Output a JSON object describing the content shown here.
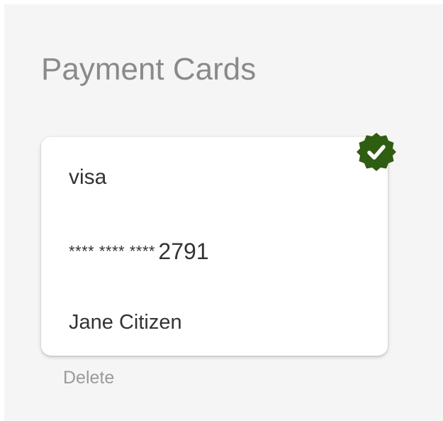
{
  "page": {
    "title": "Payment Cards"
  },
  "card": {
    "brand": "visa",
    "number_mask": "**** **** ****",
    "last4": "2791",
    "holder": "Jane Citizen",
    "is_default": true,
    "badge_icon": "verified-check-badge-icon"
  },
  "actions": {
    "delete_label": "Delete"
  },
  "colors": {
    "background": "#f5f5f5",
    "card": "#ffffff",
    "title_text": "#8a8a8a",
    "card_text": "#333333",
    "badge_fill": "#2f5d11",
    "badge_check": "#ffffff",
    "delete_text": "#9a9a9a"
  }
}
